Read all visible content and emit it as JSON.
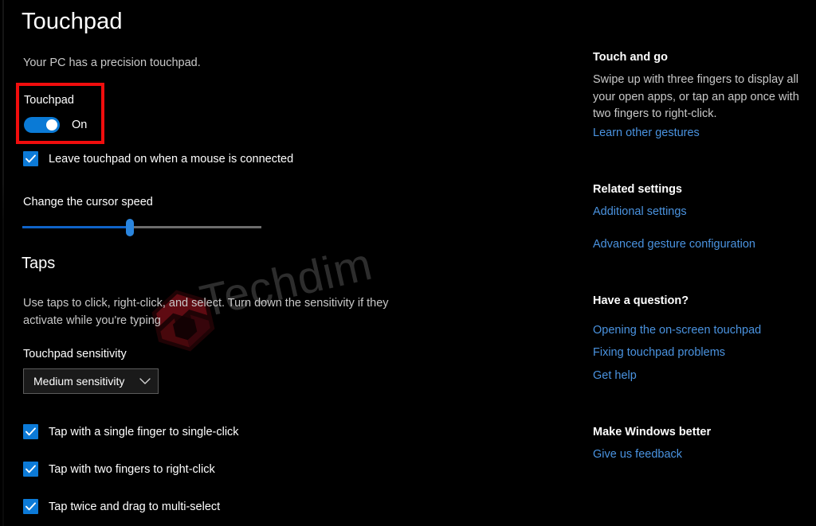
{
  "page": {
    "title": "Touchpad",
    "subtitle": "Your PC has a precision touchpad."
  },
  "touchpad_toggle": {
    "label": "Touchpad",
    "state": "On",
    "highlight_color": "#f10d0d",
    "accent_color": "#0a7ad6"
  },
  "options": {
    "leave_touchpad_on": "Leave touchpad on when a mouse is connected"
  },
  "cursor_speed": {
    "label": "Change the cursor speed",
    "value_percent": 45,
    "fill_color": "#0f63c8",
    "track_color": "#6c6c6c"
  },
  "taps": {
    "heading": "Taps",
    "description": "Use taps to click, right-click, and select. Turn down the sensitivity if they activate while you're typing",
    "sensitivity_label": "Touchpad sensitivity",
    "sensitivity_value": "Medium sensitivity",
    "checkboxes": [
      "Tap with a single finger to single-click",
      "Tap with two fingers to right-click",
      "Tap twice and drag to multi-select"
    ]
  },
  "sidebar": {
    "touch_and_go": {
      "heading": "Touch and go",
      "body": "Swipe up with three fingers to display all your open apps, or tap an app once with two fingers to right-click.",
      "link": "Learn other gestures"
    },
    "related_settings": {
      "heading": "Related settings",
      "links": [
        "Additional settings",
        "Advanced gesture configuration"
      ]
    },
    "have_a_question": {
      "heading": "Have a question?",
      "links": [
        "Opening the on-screen touchpad",
        "Fixing touchpad problems",
        "Get help"
      ]
    },
    "make_windows_better": {
      "heading": "Make Windows better",
      "links": [
        "Give us feedback"
      ]
    },
    "link_color": "#4a93e0"
  },
  "watermark": {
    "text": "Techdim",
    "text_color": "#4a4a4a",
    "logo_color": "#6b0d14"
  }
}
